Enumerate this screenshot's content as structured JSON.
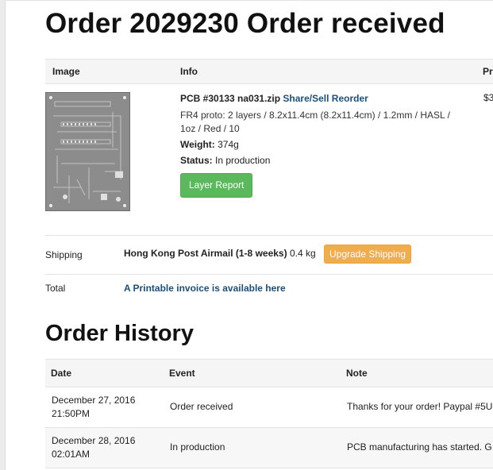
{
  "page": {
    "title": "Order 2029230 Order received"
  },
  "order": {
    "headers": {
      "image": "Image",
      "info": "Info",
      "price": "Pr"
    },
    "item": {
      "file": "PCB #30133 na031.zip",
      "share_link": "Share/Sell Reorder",
      "spec": "FR4 proto: 2 layers / 8.2x11.4cm (8.2x11.4cm) / 1.2mm / HASL / 1oz / Red / 10",
      "weight_label": "Weight:",
      "weight_value": "374g",
      "status_label": "Status:",
      "status_value": "In production",
      "layer_report_button": "Layer Report",
      "price": "$3"
    },
    "shipping": {
      "label": "Shipping",
      "method": "Hong Kong Post Airmail (1-8 weeks)",
      "weight": "0.4 kg",
      "upgrade_button": "Upgrade Shipping"
    },
    "total": {
      "label": "Total",
      "invoice_link": "A Printable invoice is available here"
    }
  },
  "history": {
    "title": "Order History",
    "headers": {
      "date": "Date",
      "event": "Event",
      "note": "Note"
    },
    "rows": [
      {
        "date_line1": "December 27, 2016",
        "date_line2": "21:50PM",
        "event": "Order received",
        "note": "Thanks for your order! Paypal #5U"
      },
      {
        "date_line1": "December 28, 2016",
        "date_line2": "02:01AM",
        "event": "In production",
        "note": "PCB manufacturing has started. G"
      }
    ]
  },
  "colors": {
    "link": "#1b4f7c",
    "success_button": "#5cb85c",
    "warning_button": "#f0ad4e"
  },
  "icons": {
    "pcb_preview": "pcb-board-image"
  }
}
